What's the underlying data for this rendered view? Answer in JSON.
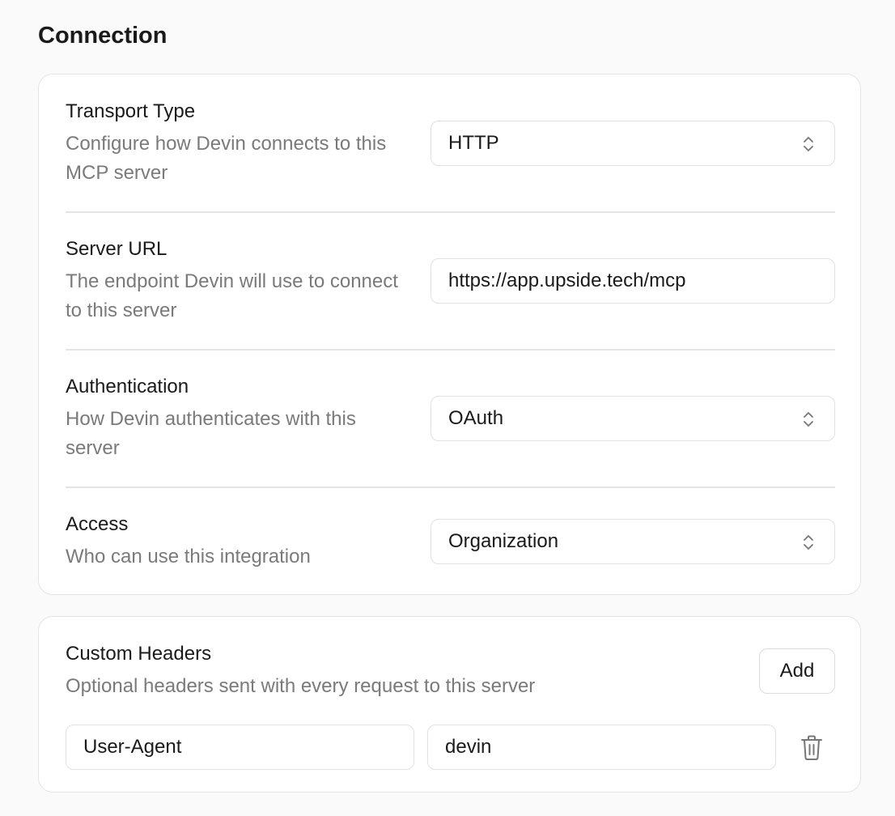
{
  "section": {
    "title": "Connection"
  },
  "connection": {
    "transport": {
      "label": "Transport Type",
      "description": "Configure how Devin connects to this MCP server",
      "value": "HTTP"
    },
    "server_url": {
      "label": "Server URL",
      "description": "The endpoint Devin will use to connect to this server",
      "value": "https://app.upside.tech/mcp"
    },
    "authentication": {
      "label": "Authentication",
      "description": "How Devin authenticates with this server",
      "value": "OAuth"
    },
    "access": {
      "label": "Access",
      "description": "Who can use this integration",
      "value": "Organization"
    }
  },
  "custom_headers": {
    "label": "Custom Headers",
    "description": "Optional headers sent with every request to this server",
    "add_label": "Add",
    "rows": [
      {
        "key": "User-Agent",
        "value": "devin"
      }
    ]
  },
  "icons": {
    "select": "chevron-up-down-icon",
    "delete": "trash-icon"
  },
  "colors": {
    "text": "#1a1a1a",
    "muted": "#7a7a7a",
    "border": "#e4e4e4",
    "background": "#fafafa"
  }
}
